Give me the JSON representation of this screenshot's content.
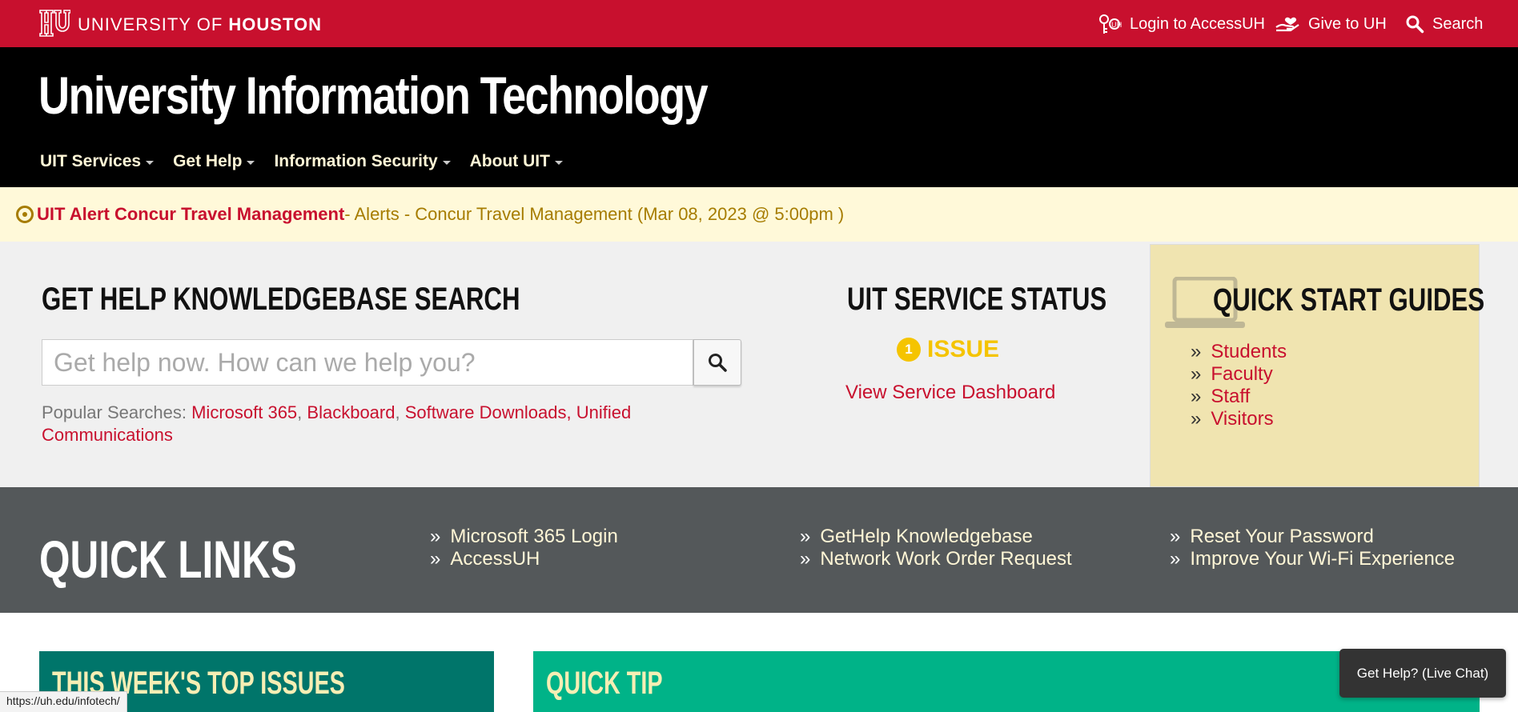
{
  "topbar": {
    "wordmark_prefix": "UNIVERSITY OF ",
    "wordmark_bold": "HOUSTON",
    "login_label": "Login to AccessUH",
    "give_label": "Give to UH",
    "search_label": "Search"
  },
  "header": {
    "site_title": "University Information Technology",
    "nav": [
      {
        "label": "UIT Services"
      },
      {
        "label": "Get Help"
      },
      {
        "label": "Information Security"
      },
      {
        "label": "About UIT"
      }
    ]
  },
  "alert": {
    "title": "UIT Alert Concur Travel Management",
    "text": " - Alerts - Concur Travel Management (Mar 08, 2023 @ 5:00pm )"
  },
  "knowledgebase": {
    "title": "GET HELP KNOWLEDGEBASE SEARCH",
    "placeholder": "Get help now. How can we help you?",
    "popular_label": "Popular Searches: ",
    "popular_links": [
      "Microsoft 365",
      "Blackboard",
      "Software Downloads, Unified Communications"
    ]
  },
  "service_status": {
    "title": "UIT SERVICE STATUS",
    "issue_count": "1",
    "issue_label": "ISSUE",
    "dashboard_link": "View Service Dashboard"
  },
  "quick_start": {
    "title": "QUICK START GUIDES",
    "items": [
      "Students",
      "Faculty",
      "Staff",
      "Visitors"
    ]
  },
  "quick_links": {
    "title": "QUICK LINKS",
    "columns": [
      [
        "Microsoft 365 Login",
        "AccessUH"
      ],
      [
        "GetHelp Knowledgebase",
        "Network Work Order Request"
      ],
      [
        "Reset Your Password",
        "Improve Your Wi-Fi Experience"
      ]
    ]
  },
  "bottom": {
    "top_issues_title": "THIS WEEK'S TOP ISSUES",
    "quick_tip_title": "QUICK TIP"
  },
  "status_bar_url": "https://uh.edu/infotech/",
  "chat_label": "Get Help? (Live Chat)",
  "colors": {
    "uh_red": "#c8102e",
    "header_black": "#000000",
    "alert_bg": "#fff9d9",
    "gold": "#f5c400",
    "slate": "#54585a",
    "teal_dark": "#00756a",
    "teal_light": "#00b388"
  }
}
